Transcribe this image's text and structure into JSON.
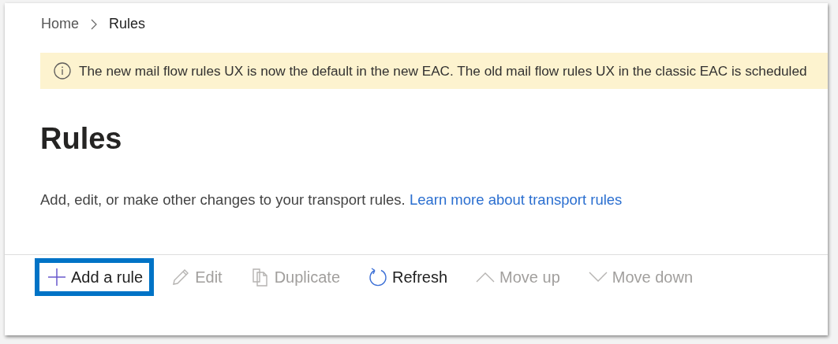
{
  "breadcrumb": [
    {
      "label": "Home"
    },
    {
      "label": "Rules"
    }
  ],
  "banner": {
    "text": "The new mail flow rules UX is now the default in the new EAC. The old mail flow rules UX in the classic EAC is scheduled"
  },
  "page_title": "Rules",
  "description": {
    "text": "Add, edit, or make other changes to your transport rules.",
    "link": "Learn more about transport rules"
  },
  "toolbar": [
    {
      "kind": "add",
      "label": "Add a rule",
      "disabled": false,
      "highlighted": true
    },
    {
      "kind": "edit",
      "label": "Edit",
      "disabled": true,
      "highlighted": false
    },
    {
      "kind": "duplicate",
      "label": "Duplicate",
      "disabled": true,
      "highlighted": false
    },
    {
      "kind": "refresh",
      "label": "Refresh",
      "disabled": false,
      "highlighted": false
    },
    {
      "kind": "up",
      "label": "Move up",
      "disabled": true,
      "highlighted": false
    },
    {
      "kind": "down",
      "label": "Move down",
      "disabled": true,
      "highlighted": false
    }
  ]
}
